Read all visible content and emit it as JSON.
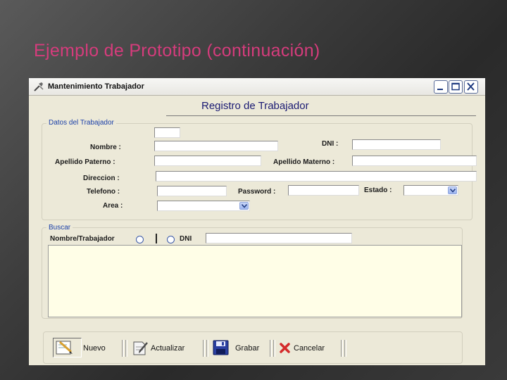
{
  "slide": {
    "title": "Ejemplo de Prototipo (continuación)"
  },
  "window": {
    "title": "Mantenimiento Trabajador"
  },
  "form": {
    "heading": "Registro de Trabajador",
    "datos_legend": "Datos del Trabajador",
    "labels": {
      "nombre": "Nombre :",
      "dni": "DNI :",
      "apellido_paterno": "Apellido Paterno :",
      "apellido_materno": "Apellido Materno :",
      "direccion": "Direccion :",
      "telefono": "Telefono :",
      "password": "Password :",
      "estado": "Estado :",
      "area": "Area :"
    },
    "values": {
      "codigo": "",
      "nombre": "",
      "dni": "",
      "apellido_paterno": "",
      "apellido_materno": "",
      "direccion": "",
      "telefono": "",
      "password": "",
      "estado": "",
      "area": ""
    }
  },
  "buscar": {
    "legend": "Buscar",
    "option_nombre": "Nombre/Trabajador",
    "option_dni": "DNI",
    "search_value": ""
  },
  "toolbar": {
    "nuevo": "Nuevo",
    "actualizar": "Actualizar",
    "grabar": "Grabar",
    "cancelar": "Cancelar"
  },
  "colors": {
    "slide_title": "#d53c7c",
    "window_bg": "#ece9d8",
    "legend_text": "#1a3fa8",
    "grid_bg": "#fffee7"
  },
  "icons": [
    "app-icon",
    "minimize-icon",
    "maximize-icon",
    "close-icon",
    "dropdown-arrow-icon",
    "nuevo-icon",
    "actualizar-icon",
    "grabar-icon",
    "cancelar-icon"
  ]
}
